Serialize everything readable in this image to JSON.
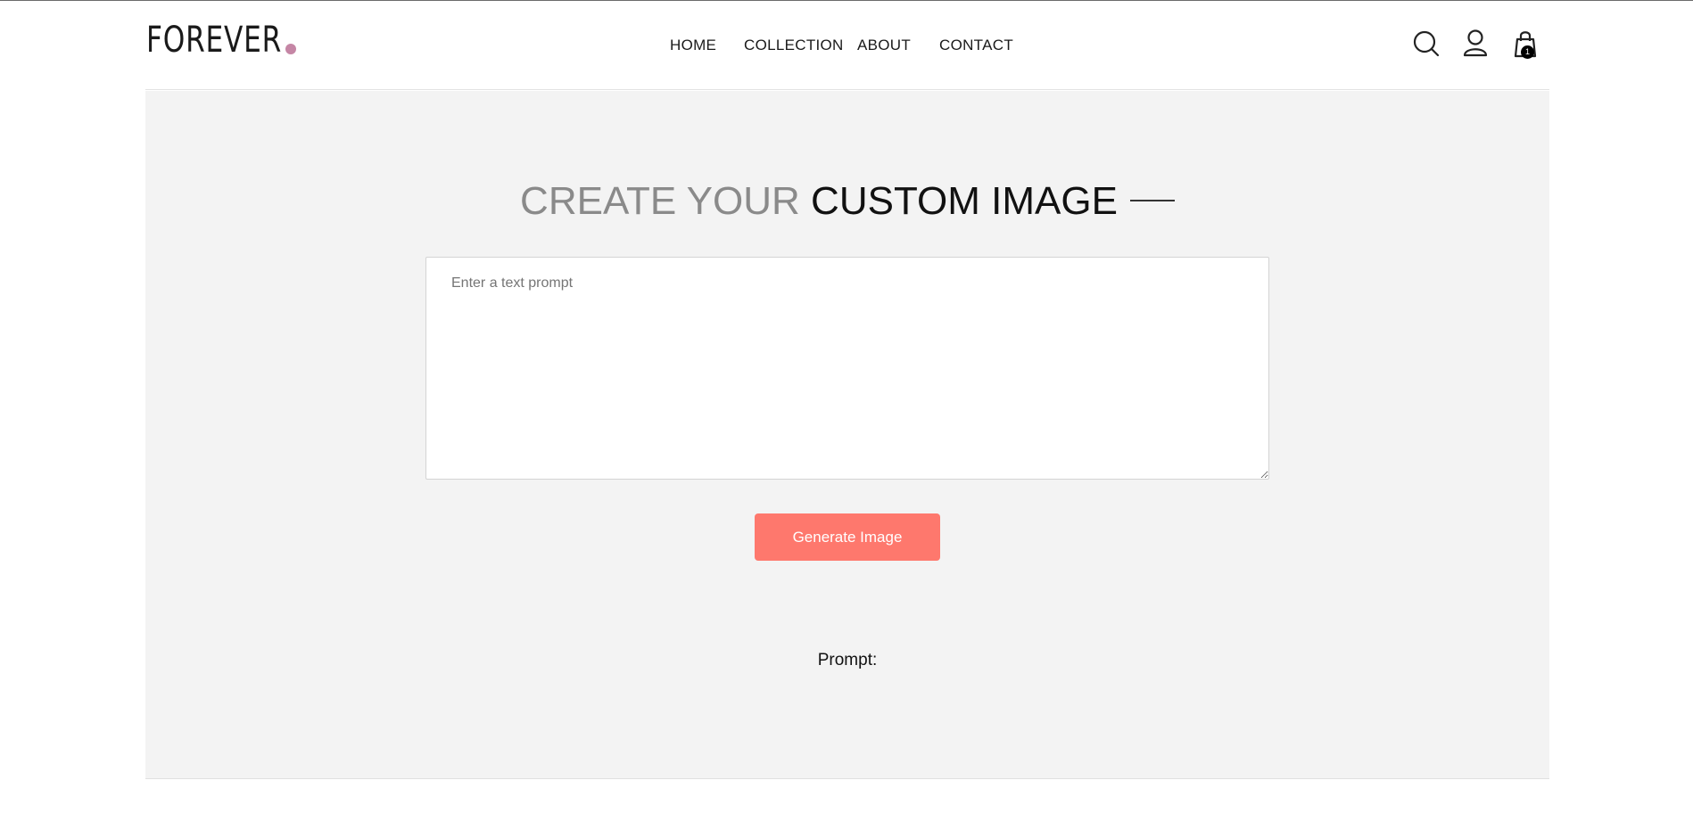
{
  "header": {
    "logo_text": "FOREVER",
    "nav": {
      "home": "HOME",
      "collection": "COLLECTION",
      "about": "ABOUT",
      "contact": "CONTACT"
    },
    "icons": {
      "search": "search-icon",
      "profile": "user-icon",
      "cart": "shopping-bag-icon"
    },
    "cart_count": "1"
  },
  "main": {
    "title_light": "CREATE YOUR",
    "title_dark": "CUSTOM IMAGE",
    "prompt_placeholder": "Enter a text prompt",
    "prompt_value": "",
    "generate_label": "Generate Image",
    "prompt_label": "Prompt:"
  },
  "colors": {
    "accent_button": "#fe786d",
    "logo_dot": "#c586a5",
    "main_background": "#f3f3f3"
  }
}
